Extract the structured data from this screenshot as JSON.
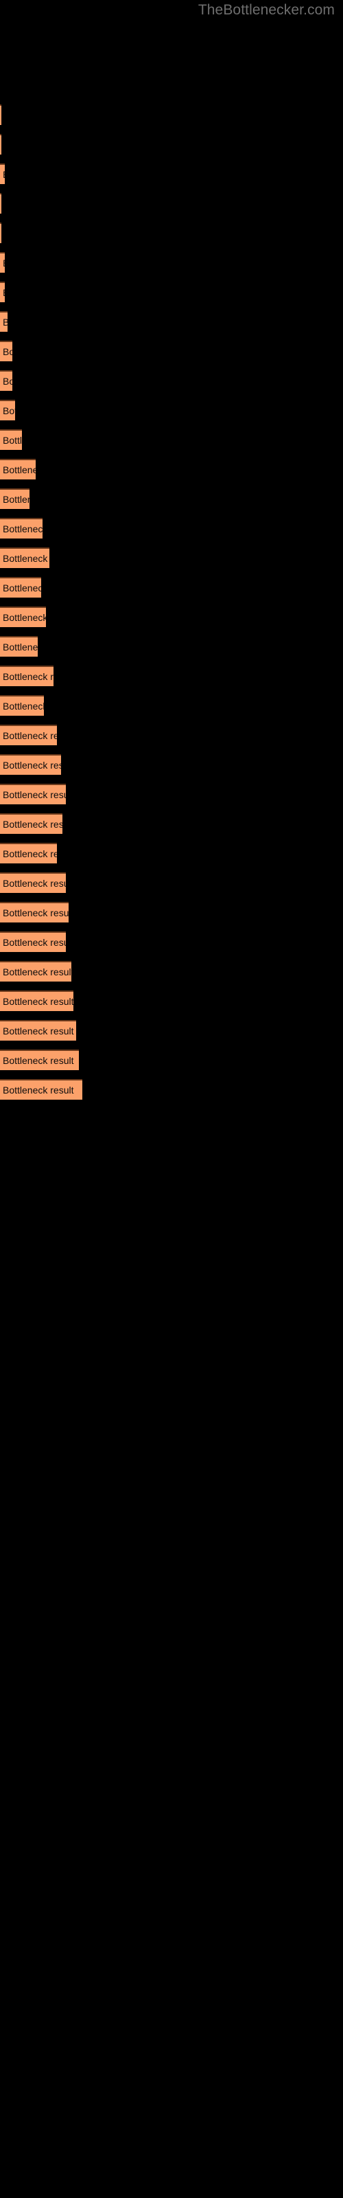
{
  "header": {
    "brand": "TheBottlenecker.com"
  },
  "chart_data": {
    "type": "bar",
    "orientation": "horizontal",
    "title": "",
    "subtitle": "",
    "xlabel": "",
    "ylabel": "",
    "grid": false,
    "legend": null,
    "bar_color": "#fca16a",
    "bar_border_color": "#6b3a1c",
    "background_color": "#000000",
    "label_color": "#0c0c0c",
    "brand_color": "#6e6e6e",
    "bar_label_text": "Bottleneck result",
    "xlim": [
      0,
      130
    ],
    "categories": [
      "Bottleneck result",
      "Bottleneck result",
      "Bottleneck result",
      "Bottleneck result",
      "Bottleneck result",
      "Bottleneck result",
      "Bottleneck result",
      "Bottleneck result",
      "Bottleneck result",
      "Bottleneck result",
      "Bottleneck result",
      "Bottleneck result",
      "Bottleneck result",
      "Bottleneck result",
      "Bottleneck result",
      "Bottleneck result",
      "Bottleneck result",
      "Bottleneck result",
      "Bottleneck result",
      "Bottleneck result",
      "Bottleneck result",
      "Bottleneck result",
      "Bottleneck result",
      "Bottleneck result",
      "Bottleneck result",
      "Bottleneck result",
      "Bottleneck result",
      "Bottleneck result",
      "Bottleneck result",
      "Bottleneck result",
      "Bottleneck result",
      "Bottleneck result",
      "Bottleneck result",
      "Bottleneck result"
    ],
    "values": [
      2,
      2,
      3,
      2,
      2,
      3,
      3,
      5,
      9,
      9,
      10,
      13,
      20,
      29,
      25,
      33,
      41,
      36,
      42,
      33,
      47,
      38,
      55,
      58,
      64,
      60,
      50,
      64,
      64,
      72,
      72,
      79,
      77,
      82
    ],
    "bars": [
      {
        "label": "Bottleneck result",
        "value": 2,
        "width": 2,
        "top": 152
      },
      {
        "label": "Bottleneck result",
        "value": 2,
        "width": 2,
        "top": 195
      },
      {
        "label": "Bottleneck result",
        "value": 3,
        "width": 7,
        "top": 238
      },
      {
        "label": "Bottleneck result",
        "value": 2,
        "width": 2,
        "top": 281
      },
      {
        "label": "Bottleneck result",
        "value": 2,
        "width": 2,
        "top": 324
      },
      {
        "label": "Bottleneck result",
        "value": 3,
        "width": 7,
        "top": 367
      },
      {
        "label": "Bottleneck result",
        "value": 3,
        "width": 7,
        "top": 410
      },
      {
        "label": "Bottleneck result",
        "value": 5,
        "width": 11,
        "top": 453
      },
      {
        "label": "Bottleneck result",
        "value": 9,
        "width": 18,
        "top": 496
      },
      {
        "label": "Bottleneck result",
        "value": 9,
        "width": 18,
        "top": 539
      },
      {
        "label": "Bottleneck result",
        "value": 10,
        "width": 22,
        "top": 582
      },
      {
        "label": "Bottleneck result",
        "value": 13,
        "width": 32,
        "top": 625
      },
      {
        "label": "Bottleneck result",
        "value": 20,
        "width": 52,
        "top": 668
      },
      {
        "label": "Bottleneck result",
        "value": 29,
        "width": 43,
        "top": 711
      },
      {
        "label": "Bottleneck result",
        "value": 25,
        "width": 62,
        "top": 754
      },
      {
        "label": "Bottleneck result",
        "value": 33,
        "width": 72,
        "top": 797
      },
      {
        "label": "Bottleneck result",
        "value": 41,
        "width": 60,
        "top": 840
      },
      {
        "label": "Bottleneck result",
        "value": 36,
        "width": 67,
        "top": 883
      },
      {
        "label": "Bottleneck result",
        "value": 42,
        "width": 55,
        "top": 926
      },
      {
        "label": "Bottleneck result",
        "value": 33,
        "width": 78,
        "top": 969
      },
      {
        "label": "Bottleneck result",
        "value": 47,
        "width": 64,
        "top": 1012
      },
      {
        "label": "Bottleneck result",
        "value": 38,
        "width": 83,
        "top": 1055
      },
      {
        "label": "Bottleneck result",
        "value": 55,
        "width": 89,
        "top": 1098
      },
      {
        "label": "Bottleneck result",
        "value": 58,
        "width": 96,
        "top": 1141
      },
      {
        "label": "Bottleneck result",
        "value": 64,
        "width": 91,
        "top": 1184
      },
      {
        "label": "Bottleneck result",
        "value": 60,
        "width": 83,
        "top": 1227
      },
      {
        "label": "Bottleneck result",
        "value": 50,
        "width": 96,
        "top": 1270
      },
      {
        "label": "Bottleneck result",
        "value": 64,
        "width": 100,
        "top": 1313
      },
      {
        "label": "Bottleneck result",
        "value": 64,
        "width": 96,
        "top": 1356
      },
      {
        "label": "Bottleneck result",
        "value": 72,
        "width": 104,
        "top": 1399
      },
      {
        "label": "Bottleneck result",
        "value": 72,
        "width": 107,
        "top": 1442
      },
      {
        "label": "Bottleneck result",
        "value": 79,
        "width": 111,
        "top": 1485
      },
      {
        "label": "Bottleneck result",
        "value": 77,
        "width": 115,
        "top": 1528
      },
      {
        "label": "Bottleneck result",
        "value": 82,
        "width": 120,
        "top": 1571
      }
    ]
  }
}
